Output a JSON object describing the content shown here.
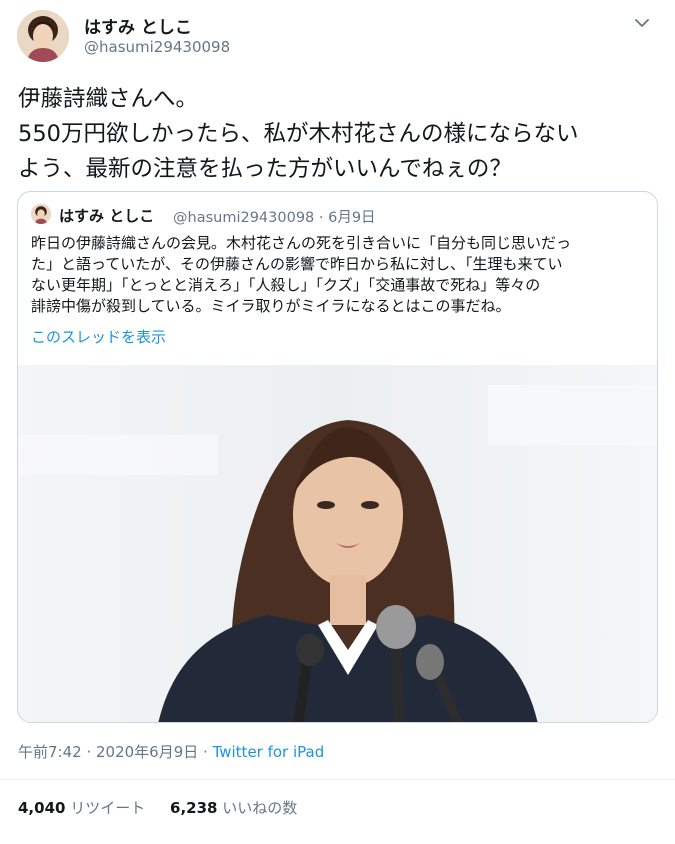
{
  "author": {
    "name": "はすみ としこ",
    "handle": "@hasumi29430098"
  },
  "tweet": {
    "lines": [
      "伊藤詩織さんへ。",
      "550万円欲しかったら、私が木村花さんの様にならない",
      "よう、最新の注意を払った方がいいんでねぇの？"
    ]
  },
  "quote": {
    "name": "はすみ としこ",
    "meta": "@hasumi29430098 · 6月9日",
    "lines": [
      "昨日の伊藤詩織さんの会見。木村花さんの死を引き合いに「自分も同じ思いだっ",
      "た」と語っていたが、その伊藤さんの影響で昨日から私に対し、「生理も来てい",
      "ない更年期」「とっとと消えろ」「人殺し」「クズ」「交通事故で死ね」等々の",
      "誹謗中傷が殺到している。ミイラ取りがミイラになるとはこの事だね。"
    ],
    "show_thread": "このスレッドを表示"
  },
  "footer": {
    "time": "午前7:42 · 2020年6月9日 · ",
    "source": "Twitter for iPad"
  },
  "stats": {
    "retweets_count": "4,040",
    "retweets_label": "リツイート",
    "likes_count": "6,238",
    "likes_label": "いいねの数"
  },
  "colors": {
    "link": "#1b95e0",
    "secondary": "#657786",
    "border": "#ccd6dd"
  },
  "icons": [
    "chevron-down-icon",
    "avatar"
  ]
}
